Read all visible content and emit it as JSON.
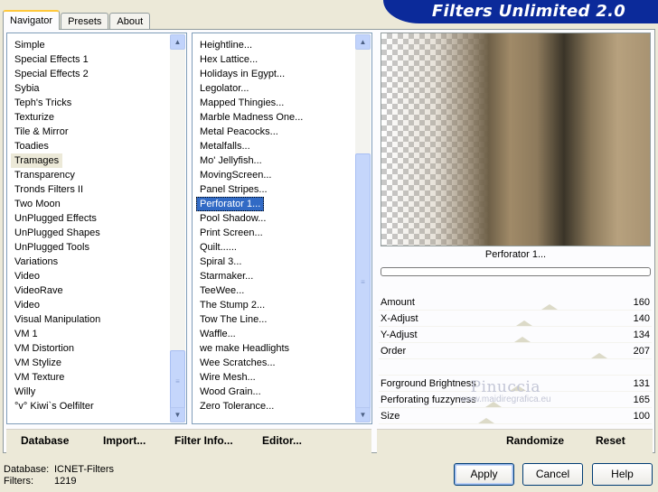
{
  "tabs": [
    {
      "label": "Navigator",
      "active": true
    },
    {
      "label": "Presets",
      "active": false
    },
    {
      "label": "About",
      "active": false
    }
  ],
  "banner": {
    "title": "Filters Unlimited 2.0"
  },
  "categories": {
    "items": [
      "Simple",
      "Special Effects 1",
      "Special Effects 2",
      "Sybia",
      "Teph's Tricks",
      "Texturize",
      "Tile & Mirror",
      "Toadies",
      "Tramages",
      "Transparency",
      "Tronds Filters II",
      "Two Moon",
      "UnPlugged Effects",
      "UnPlugged Shapes",
      "UnPlugged Tools",
      "Variations",
      "Video",
      "VideoRave",
      "Video",
      "Visual Manipulation",
      "VM 1",
      "VM Distortion",
      "VM Stylize",
      "VM Texture",
      "Willy",
      "°v° Kiwi`s Oelfilter"
    ],
    "selected": "Tramages"
  },
  "filters": {
    "items": [
      "Heightline...",
      "Hex Lattice...",
      "Holidays in Egypt...",
      "Legolator...",
      "Mapped Thingies...",
      "Marble Madness One...",
      "Metal Peacocks...",
      "Metalfalls...",
      "Mo' Jellyfish...",
      "MovingScreen...",
      "Panel Stripes...",
      "Perforator 1...",
      "Pool Shadow...",
      "Print Screen...",
      "Quilt......",
      "Spiral 3...",
      "Starmaker...",
      "TeeWee...",
      "The Stump 2...",
      "Tow The Line...",
      "Waffle...",
      "we make Headlights",
      "Wee Scratches...",
      "Wire Mesh...",
      "Wood Grain...",
      "Zero Tolerance..."
    ],
    "selected": "Perforator 1..."
  },
  "preview": {
    "caption": "Perforator 1..."
  },
  "parameters": [
    {
      "label": "Amount",
      "value": "160"
    },
    {
      "label": "X-Adjust",
      "value": "140"
    },
    {
      "label": "Y-Adjust",
      "value": "134"
    },
    {
      "label": "Order",
      "value": "207"
    },
    {
      "label": "",
      "value": ""
    },
    {
      "label": "Forground Brightness",
      "value": "131"
    },
    {
      "label": "Perforating fuzzyness",
      "value": "165"
    },
    {
      "label": "Size",
      "value": "100"
    }
  ],
  "watermark": {
    "line1": "Pinuccia",
    "line2": "www.maidiregrafica.eu"
  },
  "left_buttons": {
    "database": "Database",
    "import": "Import...",
    "filter_info": "Filter Info...",
    "editor": "Editor..."
  },
  "right_buttons": {
    "randomize": "Randomize",
    "reset": "Reset"
  },
  "status": {
    "database_label": "Database:",
    "database_value": "ICNET-Filters",
    "filters_label": "Filters:",
    "filters_value": "1219"
  },
  "dialog_buttons": {
    "apply": "Apply",
    "cancel": "Cancel",
    "help": "Help"
  }
}
